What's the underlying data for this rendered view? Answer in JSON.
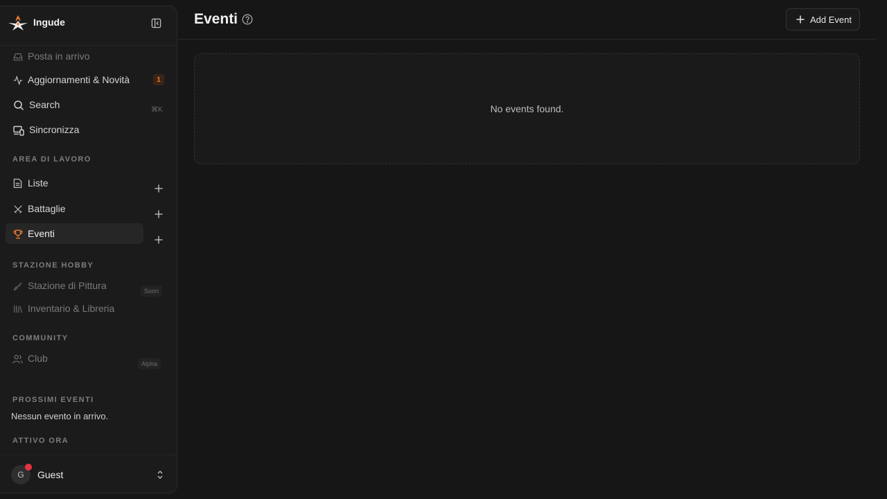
{
  "app": {
    "name": "Ingude"
  },
  "nav": {
    "items": [
      {
        "label": "Posta in arrivo",
        "icon": "inbox-icon"
      },
      {
        "label": "Aggiornamenti & Novità",
        "icon": "activity-icon",
        "badge": "1"
      },
      {
        "label": "Search",
        "icon": "search-icon",
        "shortcut": "⌘K"
      },
      {
        "label": "Sincronizza",
        "icon": "devices-icon"
      }
    ]
  },
  "workspace": {
    "title": "AREA DI LAVORO",
    "items": [
      {
        "label": "Liste",
        "icon": "file-text-icon"
      },
      {
        "label": "Battaglie",
        "icon": "swords-icon"
      },
      {
        "label": "Eventi",
        "icon": "trophy-icon",
        "active": true
      }
    ]
  },
  "hobby": {
    "title": "STAZIONE HOBBY",
    "items": [
      {
        "label": "Stazione di Pittura",
        "icon": "brush-icon",
        "tag": "Soon"
      },
      {
        "label": "Inventario & Libreria",
        "icon": "library-icon"
      }
    ]
  },
  "community": {
    "title": "COMMUNITY",
    "items": [
      {
        "label": "Club",
        "icon": "users-icon",
        "tag": "Alpha"
      }
    ]
  },
  "upcoming": {
    "title": "PROSSIMI EVENTI",
    "empty": "Nessun evento in arrivo."
  },
  "active_now": {
    "title": "ATTIVO ORA"
  },
  "user": {
    "initial": "G",
    "name": "Guest"
  },
  "page": {
    "title": "Eventi",
    "add_label": "Add Event",
    "empty_message": "No events found."
  },
  "colors": {
    "accent": "#f07a2b",
    "background": "#161616",
    "sidebar": "#1b1b1b",
    "status_dot": "#e5333f"
  }
}
